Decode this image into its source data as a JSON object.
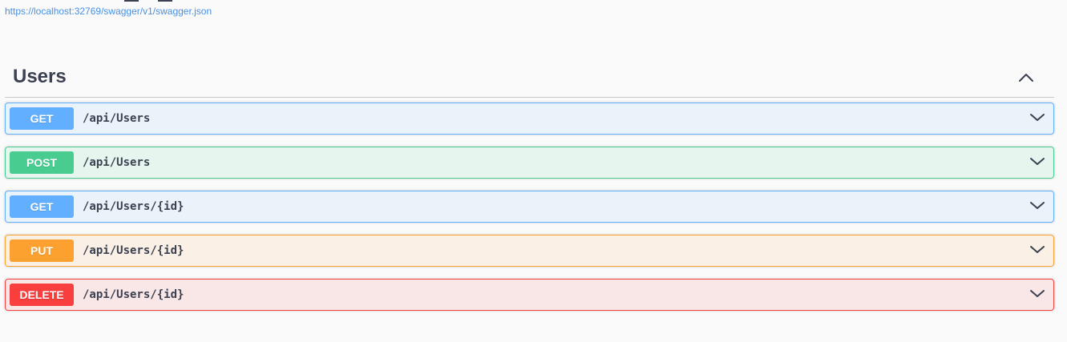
{
  "spec": {
    "url": "https://localhost:32769/swagger/v1/swagger.json"
  },
  "tag": {
    "name": "Users",
    "toggle_icon": "chevron-up-icon"
  },
  "operations": [
    {
      "method": "GET",
      "path": "/api/Users",
      "color": "#61affe"
    },
    {
      "method": "POST",
      "path": "/api/Users",
      "color": "#49cc90"
    },
    {
      "method": "GET",
      "path": "/api/Users/{id}",
      "color": "#61affe"
    },
    {
      "method": "PUT",
      "path": "/api/Users/{id}",
      "color": "#fca130"
    },
    {
      "method": "DELETE",
      "path": "/api/Users/{id}",
      "color": "#f93e3e"
    }
  ],
  "expand_icon": "chevron-down-icon"
}
